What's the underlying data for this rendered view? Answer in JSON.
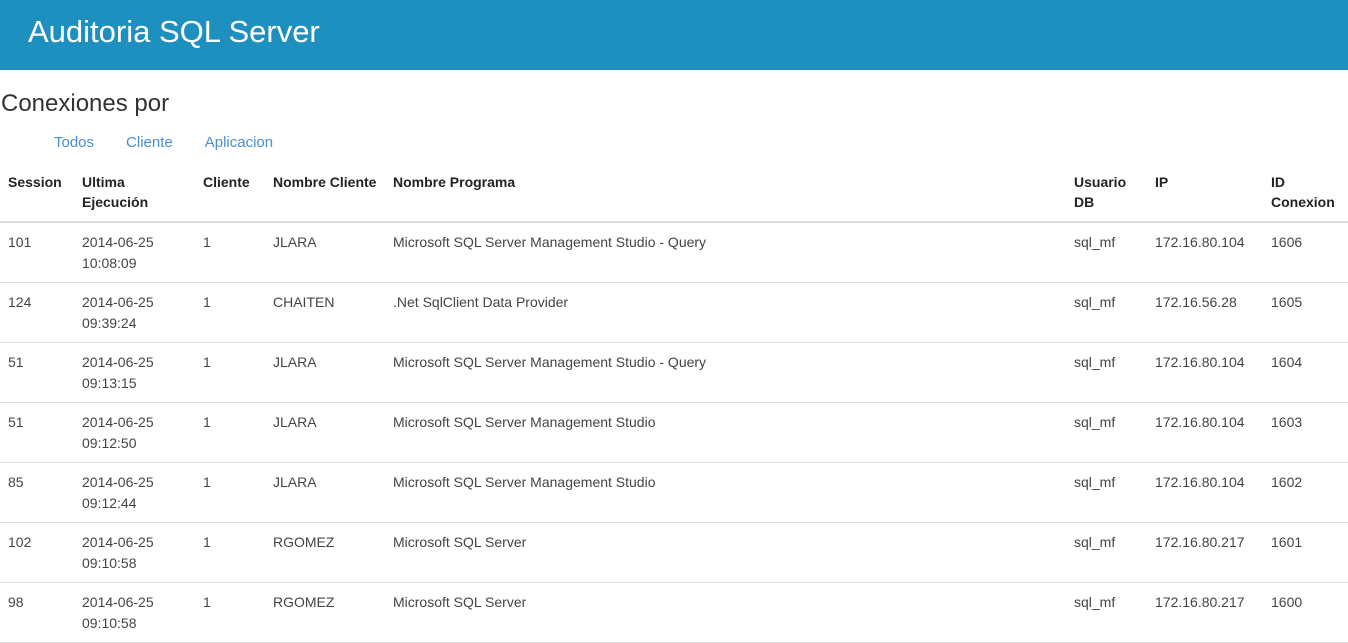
{
  "header": {
    "title": "Auditoria SQL Server"
  },
  "section": {
    "title": "Conexiones por"
  },
  "tabs": [
    {
      "label": "Todos"
    },
    {
      "label": "Cliente"
    },
    {
      "label": "Aplicacion"
    }
  ],
  "table": {
    "columns": [
      "Session",
      "Ultima Ejecución",
      "Cliente",
      "Nombre Cliente",
      "Nombre Programa",
      "Usuario DB",
      "IP",
      "ID Conexion"
    ],
    "rows": [
      [
        "101",
        "2014-06-25 10:08:09",
        "1",
        "JLARA",
        "Microsoft SQL Server Management Studio - Query",
        "sql_mf",
        "172.16.80.104",
        "1606"
      ],
      [
        "124",
        "2014-06-25 09:39:24",
        "1",
        "CHAITEN",
        ".Net SqlClient Data Provider",
        "sql_mf",
        "172.16.56.28",
        "1605"
      ],
      [
        "51",
        "2014-06-25 09:13:15",
        "1",
        "JLARA",
        "Microsoft SQL Server Management Studio - Query",
        "sql_mf",
        "172.16.80.104",
        "1604"
      ],
      [
        "51",
        "2014-06-25 09:12:50",
        "1",
        "JLARA",
        "Microsoft SQL Server Management Studio",
        "sql_mf",
        "172.16.80.104",
        "1603"
      ],
      [
        "85",
        "2014-06-25 09:12:44",
        "1",
        "JLARA",
        "Microsoft SQL Server Management Studio",
        "sql_mf",
        "172.16.80.104",
        "1602"
      ],
      [
        "102",
        "2014-06-25 09:10:58",
        "1",
        "RGOMEZ",
        "Microsoft SQL Server",
        "sql_mf",
        "172.16.80.217",
        "1601"
      ],
      [
        "98",
        "2014-06-25 09:10:58",
        "1",
        "RGOMEZ",
        "Microsoft SQL Server",
        "sql_mf",
        "172.16.80.217",
        "1600"
      ]
    ]
  },
  "colors": {
    "header": "#1e90bf",
    "link": "#4a8fcf"
  }
}
